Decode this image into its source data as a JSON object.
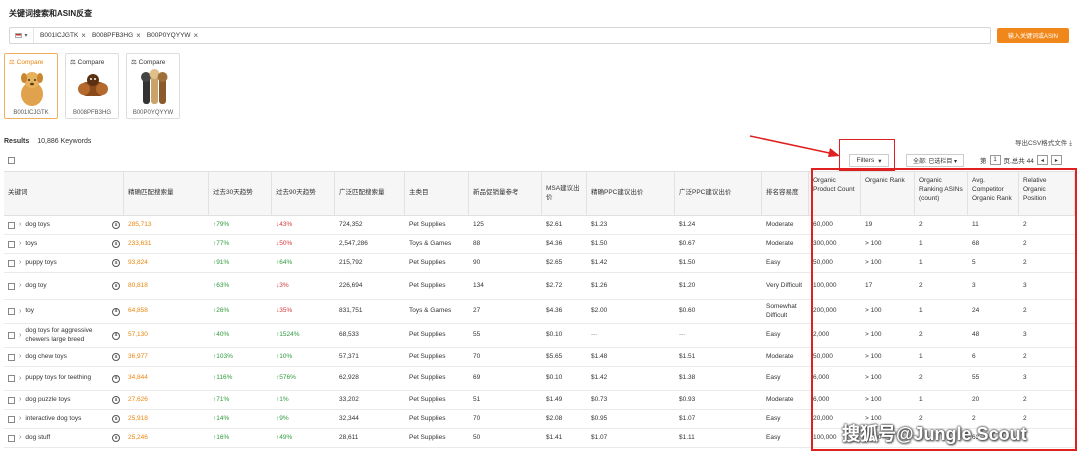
{
  "page": {
    "title": "关键词搜索和ASIN反查"
  },
  "search": {
    "country_caret": "▾",
    "asins": [
      "B001ICJGTK",
      "B008PFB3HG",
      "B00P0YQYYW"
    ],
    "remove_glyph": "×",
    "button_label": "输入关键词或ASIN"
  },
  "cards": [
    {
      "compare_label": "Compare",
      "asin": "B001ICJGTK",
      "active": true
    },
    {
      "compare_label": "Compare",
      "asin": "B008PFB3HG",
      "active": false
    },
    {
      "compare_label": "Compare",
      "asin": "B00P0YQYYW",
      "active": false
    }
  ],
  "results": {
    "label": "Results",
    "count": "10,886 Keywords",
    "export": "导出CSV格式文件"
  },
  "filters": {
    "label": "Filters",
    "caret": "▾"
  },
  "columns_select": {
    "label": "全部: 已选栏目 ▾"
  },
  "pager": {
    "prefix": "第",
    "page": "1",
    "suffix": "页,总共 44",
    "prev": "◂",
    "next": "▸"
  },
  "headers": [
    "关键词",
    "精确匹配搜索量",
    "过去30天趋势",
    "过去90天趋势",
    "广泛匹配搜索量",
    "主类目",
    "新品促销量参考",
    "MSA建议出价",
    "精确PPC建议出价",
    "广泛PPC建议出价",
    "排名容易度",
    "Organic Product Count",
    "Organic Rank",
    "Organic Ranking ASINs (count)",
    "Avg. Competitor Organic Rank",
    "Relative Organic Position"
  ],
  "rows": [
    {
      "keyword": "dog toys",
      "exact": "285,713",
      "t30": "↑79%",
      "t30_dir": "up",
      "t90": "↓43%",
      "t90_dir": "down",
      "broad": "724,352",
      "category": "Pet Supplies",
      "promo": "125",
      "msa": "$2.61",
      "exact_ppc": "$1.23",
      "broad_ppc": "$1.24",
      "ease": "Moderate",
      "opc": "60,000",
      "orank": "19",
      "oasins": "2",
      "avgrank": "11",
      "relpos": "2"
    },
    {
      "keyword": "toys",
      "exact": "233,631",
      "t30": "↑77%",
      "t30_dir": "up",
      "t90": "↓50%",
      "t90_dir": "down",
      "broad": "2,547,286",
      "category": "Toys & Games",
      "promo": "88",
      "msa": "$4.36",
      "exact_ppc": "$1.50",
      "broad_ppc": "$0.67",
      "ease": "Moderate",
      "opc": "300,000",
      "orank": "> 100",
      "oasins": "1",
      "avgrank": "68",
      "relpos": "2"
    },
    {
      "keyword": "puppy toys",
      "exact": "93,824",
      "t30": "↑91%",
      "t30_dir": "up",
      "t90": "↑64%",
      "t90_dir": "up",
      "broad": "215,792",
      "category": "Pet Supplies",
      "promo": "90",
      "msa": "$2.65",
      "exact_ppc": "$1.42",
      "broad_ppc": "$1.50",
      "ease": "Easy",
      "opc": "50,000",
      "orank": "> 100",
      "oasins": "1",
      "avgrank": "5",
      "relpos": "2"
    },
    {
      "keyword": "dog toy",
      "exact": "80,818",
      "t30": "↑63%",
      "t30_dir": "up",
      "t90": "↓3%",
      "t90_dir": "down",
      "broad": "226,694",
      "category": "Pet Supplies",
      "promo": "134",
      "msa": "$2.72",
      "exact_ppc": "$1.26",
      "broad_ppc": "$1.20",
      "ease": "Very Difficult",
      "opc": "100,000",
      "orank": "17",
      "oasins": "2",
      "avgrank": "3",
      "relpos": "3"
    },
    {
      "keyword": "toy",
      "exact": "64,858",
      "t30": "↑26%",
      "t30_dir": "up",
      "t90": "↓35%",
      "t90_dir": "down",
      "broad": "831,751",
      "category": "Toys & Games",
      "promo": "27",
      "msa": "$4.36",
      "exact_ppc": "$2.00",
      "broad_ppc": "$0.60",
      "ease": "Somewhat Difficult",
      "opc": "200,000",
      "orank": "> 100",
      "oasins": "1",
      "avgrank": "24",
      "relpos": "2"
    },
    {
      "keyword": "dog toys for aggressive chewers large breed",
      "exact": "57,130",
      "t30": "↑40%",
      "t30_dir": "up",
      "t90": "↑1524%",
      "t90_dir": "up",
      "broad": "68,533",
      "category": "Pet Supplies",
      "promo": "55",
      "msa": "$0.10",
      "exact_ppc": "---",
      "broad_ppc": "---",
      "ease": "Easy",
      "opc": "2,000",
      "orank": "> 100",
      "oasins": "2",
      "avgrank": "48",
      "relpos": "3"
    },
    {
      "keyword": "dog chew toys",
      "exact": "36,977",
      "t30": "↑103%",
      "t30_dir": "up",
      "t90": "↑10%",
      "t90_dir": "up",
      "broad": "57,371",
      "category": "Pet Supplies",
      "promo": "70",
      "msa": "$5.65",
      "exact_ppc": "$1.48",
      "broad_ppc": "$1.51",
      "ease": "Moderate",
      "opc": "50,000",
      "orank": "> 100",
      "oasins": "1",
      "avgrank": "6",
      "relpos": "2"
    },
    {
      "keyword": "puppy toys for teething",
      "exact": "34,844",
      "t30": "↑116%",
      "t30_dir": "up",
      "t90": "↑576%",
      "t90_dir": "up",
      "broad": "62,928",
      "category": "Pet Supplies",
      "promo": "69",
      "msa": "$0.10",
      "exact_ppc": "$1.42",
      "broad_ppc": "$1.38",
      "ease": "Easy",
      "opc": "6,000",
      "orank": "> 100",
      "oasins": "2",
      "avgrank": "55",
      "relpos": "3"
    },
    {
      "keyword": "dog puzzle toys",
      "exact": "27,626",
      "t30": "↑71%",
      "t30_dir": "up",
      "t90": "↑1%",
      "t90_dir": "up",
      "broad": "33,202",
      "category": "Pet Supplies",
      "promo": "51",
      "msa": "$1.49",
      "exact_ppc": "$0.73",
      "broad_ppc": "$0.93",
      "ease": "Moderate",
      "opc": "6,000",
      "orank": "> 100",
      "oasins": "1",
      "avgrank": "20",
      "relpos": "2"
    },
    {
      "keyword": "interactive dog toys",
      "exact": "25,918",
      "t30": "↑14%",
      "t30_dir": "up",
      "t90": "↑9%",
      "t90_dir": "up",
      "broad": "32,344",
      "category": "Pet Supplies",
      "promo": "70",
      "msa": "$2.08",
      "exact_ppc": "$0.95",
      "broad_ppc": "$1.07",
      "ease": "Easy",
      "opc": "20,000",
      "orank": "> 100",
      "oasins": "2",
      "avgrank": "2",
      "relpos": "2"
    },
    {
      "keyword": "dog stuff",
      "exact": "25,246",
      "t30": "↑16%",
      "t30_dir": "up",
      "t90": "↑49%",
      "t90_dir": "up",
      "broad": "28,611",
      "category": "Pet Supplies",
      "promo": "50",
      "msa": "$1.41",
      "exact_ppc": "$1.07",
      "broad_ppc": "$1.11",
      "ease": "Easy",
      "opc": "100,000",
      "orank": "> 100",
      "oasins": "1",
      "avgrank": "63",
      "relpos": "2"
    }
  ],
  "watermark": "搜狐号@Jungle Scout",
  "colors": {
    "accent": "#f0871a",
    "highlight": "#e02020",
    "up": "#2e9a3c",
    "down": "#d23a3a"
  }
}
